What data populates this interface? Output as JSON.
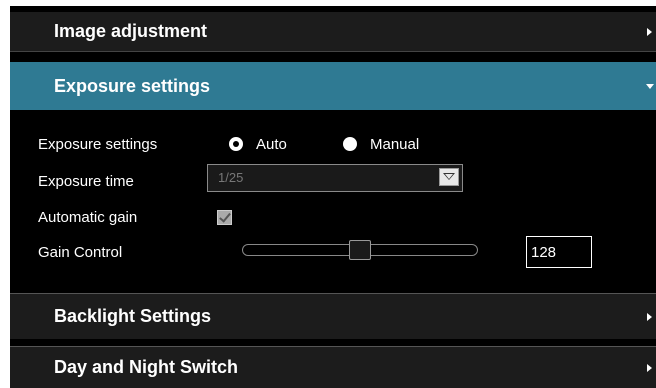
{
  "sections": {
    "image_adjustment": {
      "title": "Image adjustment"
    },
    "exposure": {
      "title": "Exposure settings"
    },
    "backlight": {
      "title": "Backlight Settings"
    },
    "day_night": {
      "title": "Day and Night Switch"
    }
  },
  "exposure_panel": {
    "mode": {
      "label": "Exposure settings",
      "options": [
        "Auto",
        "Manual"
      ],
      "selected": "Auto"
    },
    "time": {
      "label": "Exposure time",
      "value": "1/25"
    },
    "auto_gain": {
      "label": "Automatic gain",
      "checked": true
    },
    "gain": {
      "label": "Gain Control",
      "value": "128"
    }
  },
  "colors": {
    "active_header": "#2f7a93",
    "header_bg": "#1c1c1c",
    "panel_bg": "#000000"
  }
}
